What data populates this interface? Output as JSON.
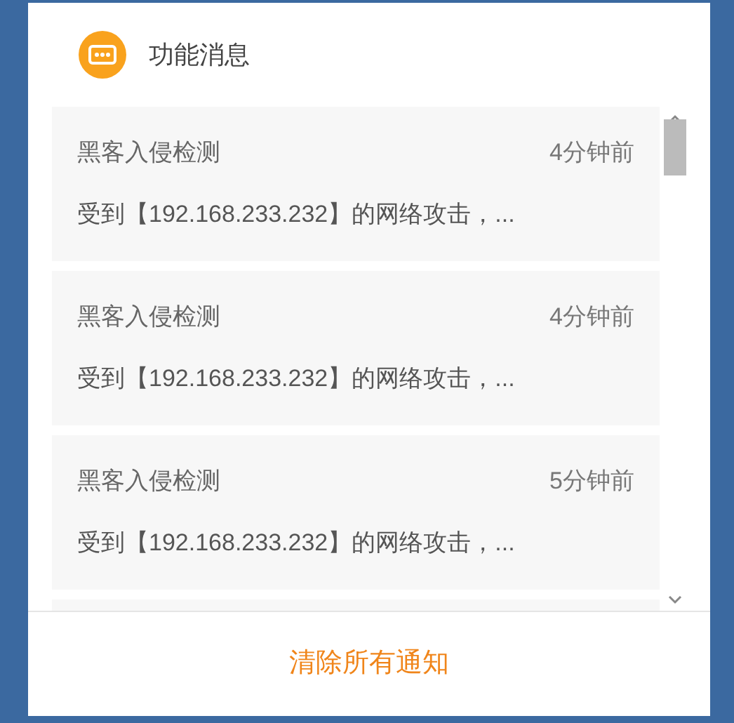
{
  "header": {
    "title": "功能消息"
  },
  "notifications": [
    {
      "title": "黑客入侵检测",
      "time": "4分钟前",
      "message": "受到【192.168.233.232】的网络攻击，..."
    },
    {
      "title": "黑客入侵检测",
      "time": "4分钟前",
      "message": "受到【192.168.233.232】的网络攻击，..."
    },
    {
      "title": "黑客入侵检测",
      "time": "5分钟前",
      "message": "受到【192.168.233.232】的网络攻击，..."
    }
  ],
  "footer": {
    "button": "清除所有通知"
  }
}
